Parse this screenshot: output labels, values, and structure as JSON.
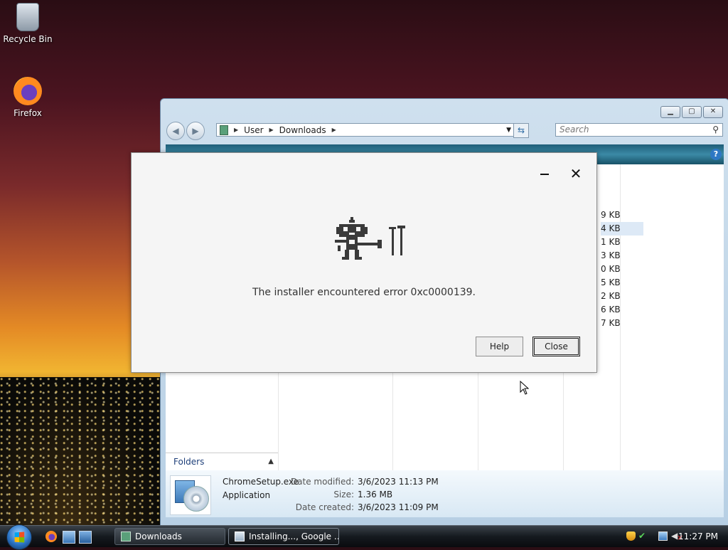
{
  "desktop": {
    "icons": [
      {
        "label": "Recycle Bin",
        "icon": "recycle-bin-icon"
      },
      {
        "label": "Firefox",
        "icon": "firefox-icon"
      }
    ]
  },
  "explorer": {
    "breadcrumb": [
      "User",
      "Downloads"
    ],
    "search_placeholder": "Search",
    "partial_sizes": [
      "9 KB",
      "4 KB",
      "1 KB",
      "3 KB",
      "0 KB",
      "5 KB",
      "2 KB",
      "6 KB",
      "7 KB"
    ],
    "folders_label": "Folders",
    "details": {
      "name": "ChromeSetup.exe",
      "type": "Application",
      "modified_label": "Date modified:",
      "modified_value": "3/6/2023 11:13 PM",
      "size_label": "Size:",
      "size_value": "1.36 MB",
      "created_label": "Date created:",
      "created_value": "3/6/2023 11:09 PM"
    }
  },
  "dialog": {
    "message": "The installer encountered error 0xc0000139.",
    "help_label": "Help",
    "close_label": "Close"
  },
  "taskbar": {
    "tasks": [
      {
        "label": "Downloads"
      },
      {
        "label": "Installing..., Google ..."
      }
    ],
    "clock": "11:27 PM"
  }
}
